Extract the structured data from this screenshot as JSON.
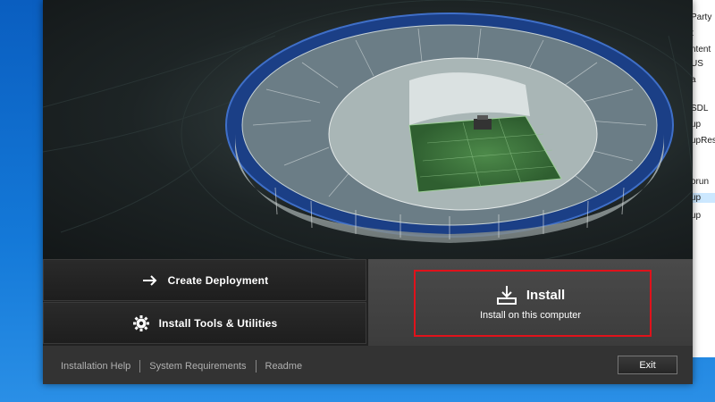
{
  "background_explorer": {
    "items": [
      "Party",
      "t",
      "ntent",
      "US",
      "a",
      "SDL",
      "up",
      "upRes",
      "orun",
      "up",
      "up"
    ]
  },
  "installer": {
    "options": {
      "create_deployment": {
        "label": "Create Deployment",
        "icon": "arrow-right-icon"
      },
      "install_tools": {
        "label": "Install Tools & Utilities",
        "icon": "gear-icon"
      }
    },
    "install": {
      "title": "Install",
      "subtitle": "Install on this computer",
      "icon": "download-tray-icon",
      "highlight_color": "#e0121b"
    },
    "footer": {
      "links": [
        "Installation Help",
        "System Requirements",
        "Readme"
      ],
      "exit_label": "Exit"
    }
  }
}
